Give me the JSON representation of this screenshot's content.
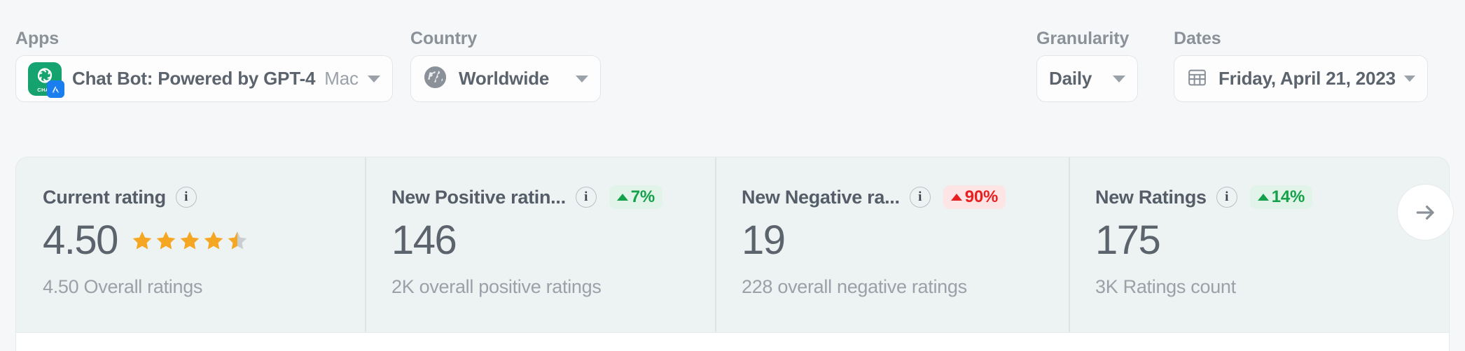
{
  "filters": {
    "apps": {
      "label": "Apps",
      "app_name": "Chat Bot: Powered by GPT-4",
      "platform": "Mac",
      "icon_word": "CHAT"
    },
    "country": {
      "label": "Country",
      "value": "Worldwide"
    },
    "granularity": {
      "label": "Granularity",
      "value": "Daily"
    },
    "dates": {
      "label": "Dates",
      "value": "Friday, April 21, 2023"
    }
  },
  "colors": {
    "positive": "#15a14a",
    "positive_bg": "#e2f4e9",
    "negative": "#e8201f",
    "negative_bg": "#fde5e5",
    "star": "#f5a623",
    "star_empty": "#c9ced3",
    "app_icon": "#16a06a",
    "store_badge": "#1a7ef0",
    "card_bg": "#edf2f2"
  },
  "cards": [
    {
      "title": "Current rating",
      "value": "4.50",
      "subtitle": "4.50 Overall ratings",
      "rating": 4.5,
      "has_stars": true,
      "delta": null
    },
    {
      "title": "New Positive ratin...",
      "value": "146",
      "subtitle": "2K overall positive ratings",
      "has_stars": false,
      "delta": {
        "text": "7%",
        "direction": "up"
      }
    },
    {
      "title": "New Negative ra...",
      "value": "19",
      "subtitle": "228 overall negative ratings",
      "has_stars": false,
      "delta": {
        "text": "90%",
        "direction": "down"
      }
    },
    {
      "title": "New Ratings",
      "value": "175",
      "subtitle": "3K Ratings count",
      "has_stars": false,
      "delta": {
        "text": "14%",
        "direction": "up"
      }
    }
  ],
  "controls": {
    "next_arrow": "→"
  }
}
